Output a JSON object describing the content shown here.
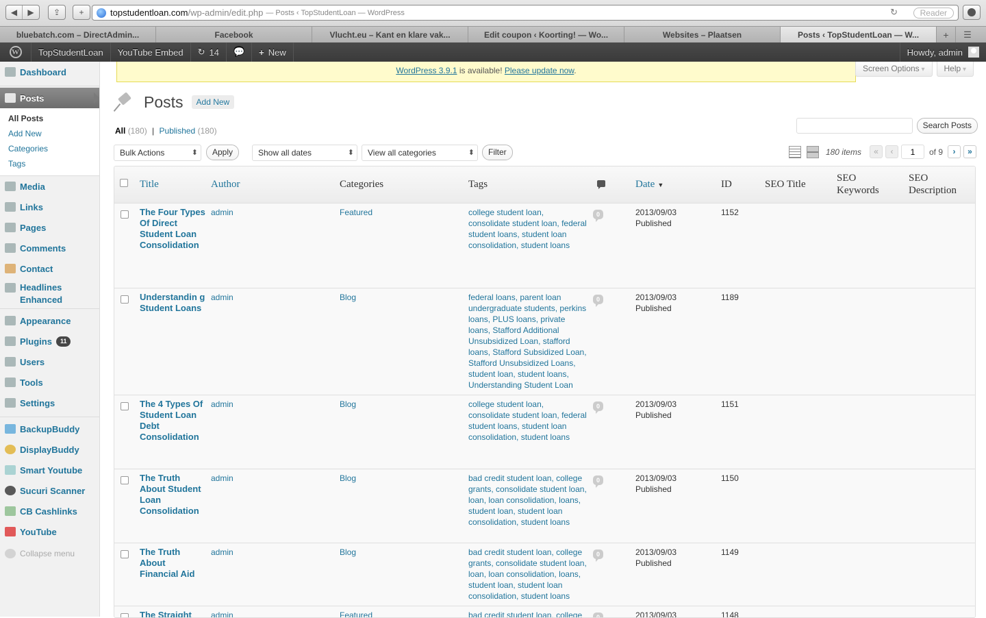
{
  "browser": {
    "url_host": "topstudentloan.com",
    "url_path": "/wp-admin/edit.php",
    "page_title": "— Posts ‹ TopStudentLoan — WordPress",
    "reader_label": "Reader",
    "tabs": [
      "bluebatch.com – DirectAdmin...",
      "Facebook",
      "Vlucht.eu – Kant en klare vak...",
      "Edit coupon ‹ Koorting! — Wo...",
      "Websites – Plaatsen",
      "Posts ‹ TopStudentLoan — W..."
    ]
  },
  "adminbar": {
    "site_name": "TopStudentLoan",
    "youtube_embed": "YouTube Embed",
    "updates_count": "14",
    "new_label": "New",
    "howdy": "Howdy, admin"
  },
  "sidebar": {
    "dashboard": "Dashboard",
    "posts": "Posts",
    "posts_sub": [
      "All Posts",
      "Add New",
      "Categories",
      "Tags"
    ],
    "media": "Media",
    "links": "Links",
    "pages": "Pages",
    "comments": "Comments",
    "contact": "Contact",
    "headlines_1": "Headlines",
    "headlines_2": "Enhanced",
    "appearance": "Appearance",
    "plugins": "Plugins",
    "plugins_badge": "11",
    "users": "Users",
    "tools": "Tools",
    "settings": "Settings",
    "backupbuddy": "BackupBuddy",
    "displaybuddy": "DisplayBuddy",
    "smart_youtube": "Smart Youtube",
    "sucuri": "Sucuri Scanner",
    "cashlinks": "CB Cashlinks",
    "youtube": "YouTube",
    "collapse": "Collapse menu"
  },
  "notice": {
    "version_link": "WordPress 3.9.1",
    "middle": " is available! ",
    "update_link": "Please update now",
    "end": "."
  },
  "screen_options": "Screen Options",
  "help": "Help",
  "heading": {
    "title": "Posts",
    "add_new": "Add New"
  },
  "views": {
    "all": "All",
    "all_count": "(180)",
    "sep": "|",
    "published": "Published",
    "published_count": "(180)"
  },
  "search": {
    "button": "Search Posts"
  },
  "tablenav": {
    "bulk_actions": "Bulk Actions",
    "apply": "Apply",
    "dates": "Show all dates",
    "categories": "View all categories",
    "filter": "Filter",
    "items": "180 items",
    "first": "«",
    "prev": "‹",
    "page": "1",
    "of": "of 9",
    "next": "›",
    "last": "»"
  },
  "columns": {
    "title": "Title",
    "author": "Author",
    "categories": "Categories",
    "tags": "Tags",
    "date": "Date",
    "id": "ID",
    "seo_title": "SEO Title",
    "seo_keywords": "SEO Keywords",
    "seo_description": "SEO Description"
  },
  "posts": [
    {
      "title": "The Four Types Of Direct Student Loan Consolidation",
      "author": "admin",
      "category": "Featured",
      "tags": "college student loan, consolidate student loan, federal student loans, student loan consolidation, student loans",
      "comments": "0",
      "date": "2013/09/03",
      "status": "Published",
      "id": "1152"
    },
    {
      "title": "Understandin g Student Loans",
      "author": "admin",
      "category": "Blog",
      "tags": "federal loans, parent loan undergraduate students, perkins loans, PLUS loans, private loans, Stafford Additional Unsubsidized Loan, stafford loans, Stafford Subsidized Loan, Stafford Unsubsidized Loans, student loan, student loans, Understanding Student Loan",
      "comments": "0",
      "date": "2013/09/03",
      "status": "Published",
      "id": "1189"
    },
    {
      "title": "The 4 Types Of Student Loan Debt Consolidation",
      "author": "admin",
      "category": "Blog",
      "tags": "college student loan, consolidate student loan, federal student loans, student loan consolidation, student loans",
      "comments": "0",
      "date": "2013/09/03",
      "status": "Published",
      "id": "1151"
    },
    {
      "title": "The Truth About Student Loan Consolidation",
      "author": "admin",
      "category": "Blog",
      "tags": "bad credit student loan, college grants, consolidate student loan, loan, loan consolidation, loans, student loan, student loan consolidation, student loans",
      "comments": "0",
      "date": "2013/09/03",
      "status": "Published",
      "id": "1150"
    },
    {
      "title": "The Truth About Financial Aid",
      "author": "admin",
      "category": "Blog",
      "tags": "bad credit student loan, college grants, consolidate student loan, loan, loan consolidation, loans, student loan, student loan consolidation, student loans",
      "comments": "0",
      "date": "2013/09/03",
      "status": "Published",
      "id": "1149"
    },
    {
      "title": "The Straight",
      "author": "admin",
      "category": "Featured",
      "tags": "bad credit student loan, college",
      "comments": "0",
      "date": "2013/09/03",
      "status": "",
      "id": "1148"
    }
  ]
}
